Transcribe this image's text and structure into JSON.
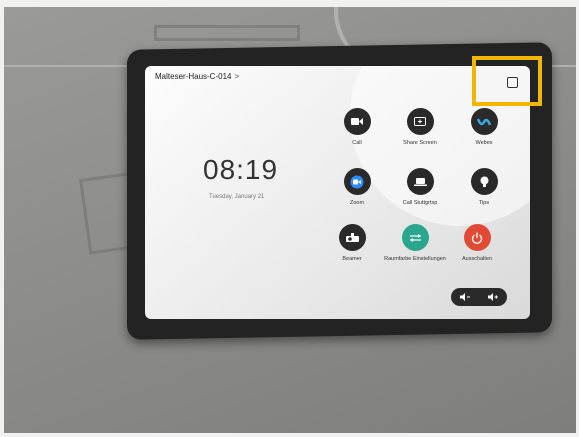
{
  "header": {
    "room_name": "Malteser-Haus-C-014",
    "chevron": ">"
  },
  "clock": {
    "time": "08:19",
    "date": "Tuesday, January 21"
  },
  "tiles": [
    {
      "label": "Call",
      "icon": "video-camera-icon"
    },
    {
      "label": "Share Screen",
      "icon": "share-screen-icon"
    },
    {
      "label": "Webex",
      "icon": "webex-icon"
    },
    {
      "label": "Zoom",
      "icon": "zoom-icon"
    },
    {
      "label": "Call Stuttgrtsp",
      "icon": "laptop-call-icon"
    },
    {
      "label": "Tips",
      "icon": "lightbulb-icon"
    },
    {
      "label": "Beamer",
      "icon": "projector-icon"
    },
    {
      "label": "Raumfarbe Einstellungen",
      "icon": "settings-arrows-icon"
    },
    {
      "label": "Ausschalten",
      "icon": "power-icon"
    }
  ],
  "colors": {
    "highlight": "#f2b705",
    "tile_dark": "#2a2a2a",
    "tile_green": "#2aa58e",
    "tile_red": "#e14a35"
  }
}
